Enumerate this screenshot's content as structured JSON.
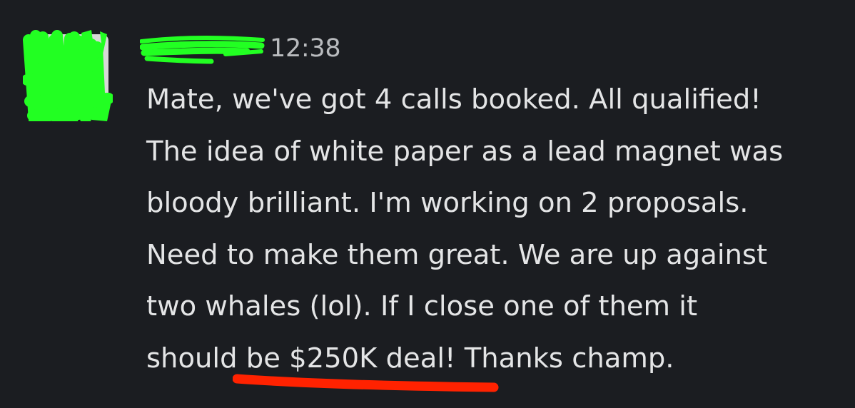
{
  "message": {
    "sender_name": "",
    "timestamp": "12:38",
    "body_lines": [
      "Mate, we've got 4 calls booked. All qualified!",
      "The idea of white paper as a lead magnet was",
      "bloody brilliant. I'm working on 2 proposals.",
      "Need to make them great. We are up against",
      "two whales (lol). If I close one of them it",
      "should be $250K deal! Thanks champ."
    ]
  },
  "colors": {
    "background": "#1b1d21",
    "text": "#e4e5e6",
    "timestamp": "#b9bbbe",
    "redaction": "#22ff22",
    "underline": "#ff2200"
  }
}
